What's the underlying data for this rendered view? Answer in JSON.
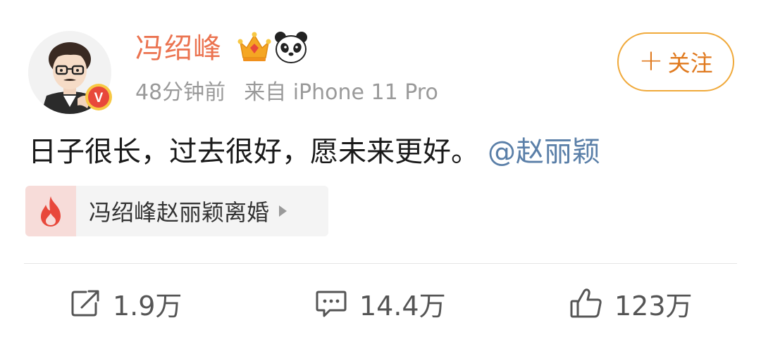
{
  "post": {
    "author": {
      "name": "冯绍峰",
      "verified_badge_letter": "V",
      "badges": [
        "crown-icon",
        "panda-icon"
      ]
    },
    "meta": {
      "time": "48分钟前",
      "source": "来自 iPhone 11 Pro"
    },
    "follow_button": {
      "plus": "+",
      "label": "关注"
    },
    "content": {
      "text": "日子很长，过去很好，愿未来更好。",
      "mention": "@赵丽颖"
    },
    "topic": {
      "icon": "fire-icon",
      "title": "冯绍峰赵丽颖离婚"
    },
    "actions": {
      "share": {
        "icon": "share-icon",
        "count": "1.9万"
      },
      "comment": {
        "icon": "comment-icon",
        "count": "14.4万"
      },
      "like": {
        "icon": "thumbs-up-icon",
        "count": "123万"
      }
    }
  },
  "colors": {
    "username": "#eb7350",
    "follow_border": "#f0a93a",
    "follow_text": "#e07a1f",
    "mention": "#5a7fa8",
    "meta": "#9a9a9a",
    "fire": "#e8483b",
    "verified": "#e8483b"
  }
}
